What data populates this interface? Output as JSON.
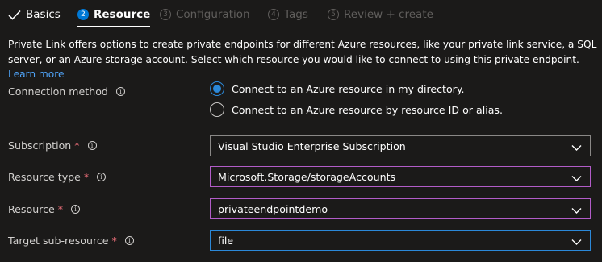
{
  "wizard": {
    "tabs": [
      {
        "label": "Basics",
        "state": "done"
      },
      {
        "label": "Resource",
        "state": "active",
        "step": "2"
      },
      {
        "label": "Configuration",
        "state": "disabled",
        "step": "3"
      },
      {
        "label": "Tags",
        "state": "disabled",
        "step": "4"
      },
      {
        "label": "Review + create",
        "state": "disabled",
        "step": "5"
      }
    ]
  },
  "description": {
    "text": "Private Link offers options to create private endpoints for different Azure resources, like your private link service, a SQL server, or an Azure storage account. Select which resource you would like to connect to using this private endpoint.",
    "link": "Learn more"
  },
  "form": {
    "connection_method": {
      "label": "Connection method",
      "options": [
        {
          "label": "Connect to an Azure resource in my directory.",
          "selected": true
        },
        {
          "label": "Connect to an Azure resource by resource ID or alias.",
          "selected": false
        }
      ]
    },
    "subscription": {
      "label": "Subscription",
      "required": "*",
      "value": "Visual Studio Enterprise Subscription"
    },
    "resource_type": {
      "label": "Resource type",
      "required": "*",
      "value": "Microsoft.Storage/storageAccounts"
    },
    "resource": {
      "label": "Resource",
      "required": "*",
      "value": "privateendpointdemo"
    },
    "target_sub_resource": {
      "label": "Target sub-resource",
      "required": "*",
      "value": "file"
    }
  },
  "icons": {
    "info": "info-icon",
    "chevron": "chevron-down-icon",
    "check": "check-icon"
  },
  "colors": {
    "accent": "#0078d4",
    "link": "#4fa3f7",
    "required": "#f1707b",
    "focus_purple": "#b25cc8",
    "background": "#1b1a19"
  }
}
